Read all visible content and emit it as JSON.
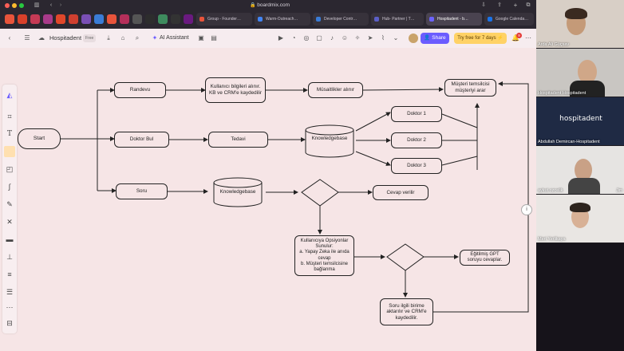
{
  "browser": {
    "url": "boardmix.com",
    "tabs": [
      {
        "label": "Group - Founder…"
      },
      {
        "label": "Warm-Outreach…"
      },
      {
        "label": "Developer Contr…"
      },
      {
        "label": "Hub- Partner | T…"
      },
      {
        "label": "Hospitadent - b…"
      },
      {
        "label": "Google Calenda…"
      }
    ]
  },
  "app": {
    "board_title": "Hospitadent",
    "plan_badge": "Free",
    "ai_assistant": "AI Assistant",
    "share_label": "Share",
    "trial_label": "Try free for 7 days",
    "trial_icon": "lightning-icon",
    "notification_count": "9"
  },
  "flow": {
    "start": "Start",
    "randevu": "Randevu",
    "kullanici_bilgi": "Kullanıcı bilgileri alınır. KB ve CRM'e kaydedilir",
    "musaitlikler": "Müsaitlikler alınır",
    "musteri_temsilcisi": "Müşteri temsilcisi müşteriyi arar",
    "doktor_bul": "Doktor Bul",
    "tedavi": "Tedavi",
    "knowledgebase_1": "Knowledgebase",
    "doktor_1": "Doktor 1",
    "doktor_2": "Doktor 2",
    "doktor_3": "Doktor 3",
    "soru": "Soru",
    "knowledgebase_2": "Knowledgebase",
    "cevap_verilir": "Cevap verilir",
    "opsiyonlar": "Kullanıcıya Opsiyonlar Sunulur:\na. Yapay Zeka ile anıda cevap\nb. Müşteri temsilcisine bağlanma",
    "egitilmis_gpt": "Eğitilmiş GPT soruyu cevaplar.",
    "soru_ilgili": "Soru ilgili birime aktarılır ve CRM'e kaydedilir."
  },
  "participants": [
    {
      "name": "Arda Ali Güçsav"
    },
    {
      "name": "Hospitadent Hospitadent"
    },
    {
      "name": "Abdullah Demircan-Hospitadent",
      "logo_text": "hospitadent"
    },
    {
      "name": "aykut.ozcelik"
    },
    {
      "name": "Mert Yerlikaya"
    }
  ],
  "partial_label": "Jim"
}
